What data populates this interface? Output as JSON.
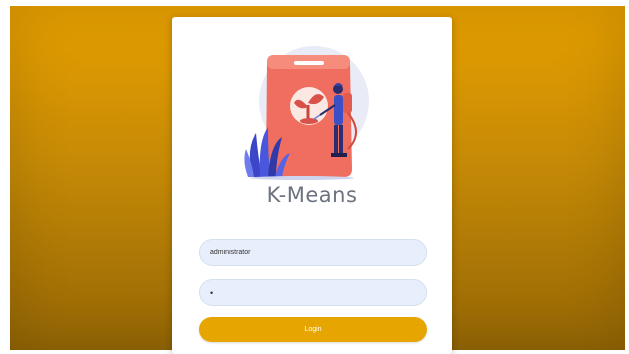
{
  "app": {
    "title": "K-Means"
  },
  "login": {
    "username_value": "administrator",
    "password_value": "•",
    "button_label": "Login"
  },
  "icons": {
    "illustration": "farmer-spraying-fertilizer-bag-illustration"
  },
  "colors": {
    "background": "#d99a03",
    "accent": "#e6a500",
    "input_bg": "#e8effc",
    "title": "#6b7280"
  }
}
